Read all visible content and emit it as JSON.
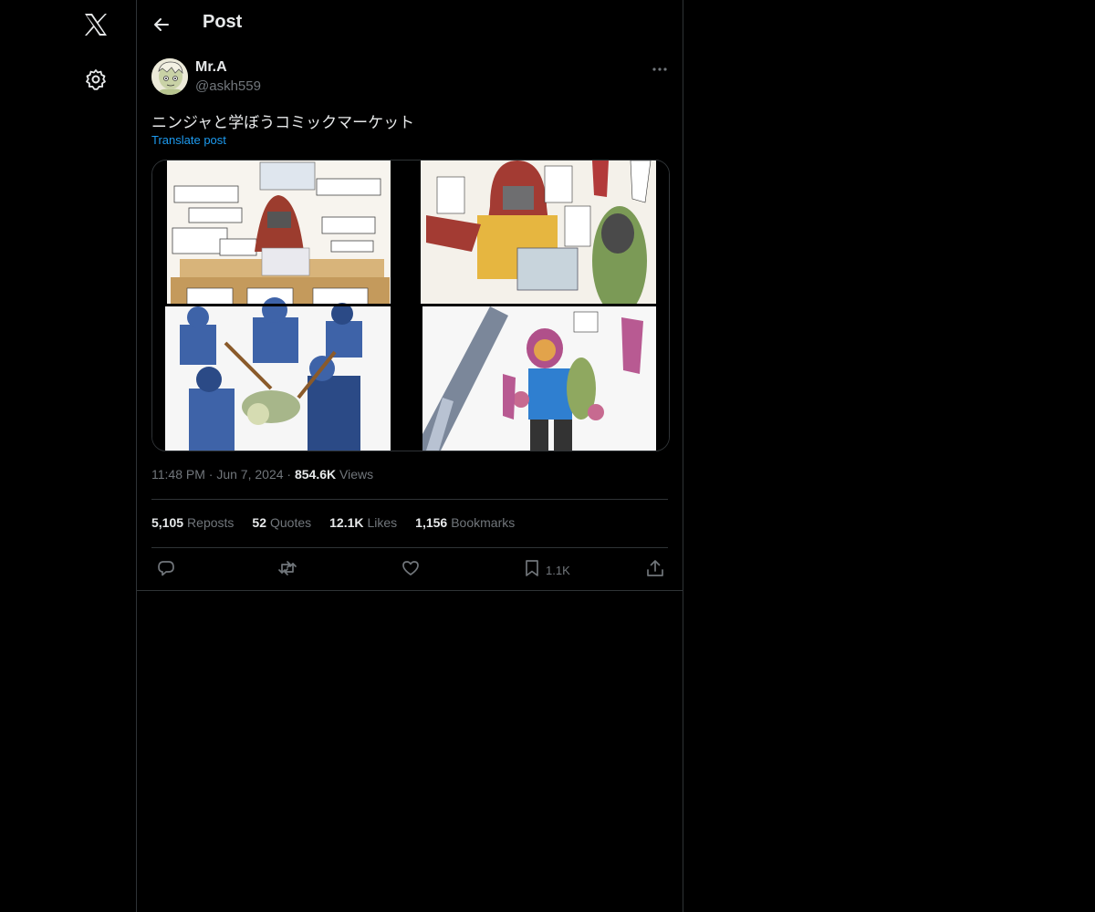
{
  "nav": {
    "logo_icon": "x-logo-icon",
    "settings_icon": "gear-icon"
  },
  "header": {
    "title": "Post",
    "back_icon": "arrow-left-icon"
  },
  "post": {
    "author": {
      "display_name": "Mr.A",
      "handle": "@askh559"
    },
    "text": "ニンジャと学ぼうコミックマーケット",
    "translate_label": "Translate post",
    "media": {
      "type": "image",
      "panels": 4
    },
    "time": "11:48 PM",
    "date": "Jun 7, 2024",
    "views_count": "854.6K",
    "views_label": "Views",
    "stats": {
      "reposts_count": "5,105",
      "reposts_label": "Reposts",
      "quotes_count": "52",
      "quotes_label": "Quotes",
      "likes_count": "12.1K",
      "likes_label": "Likes",
      "bookmarks_count": "1,156",
      "bookmarks_label": "Bookmarks"
    },
    "actions": {
      "reply_icon": "reply-icon",
      "repost_icon": "repost-icon",
      "like_icon": "heart-icon",
      "bookmark_icon": "bookmark-icon",
      "bookmark_count": "1.1K",
      "share_icon": "share-icon"
    }
  },
  "colors": {
    "background": "#000000",
    "text_primary": "#e7e9ea",
    "text_secondary": "#71767b",
    "link": "#1d9bf0",
    "border": "#2f3336"
  }
}
